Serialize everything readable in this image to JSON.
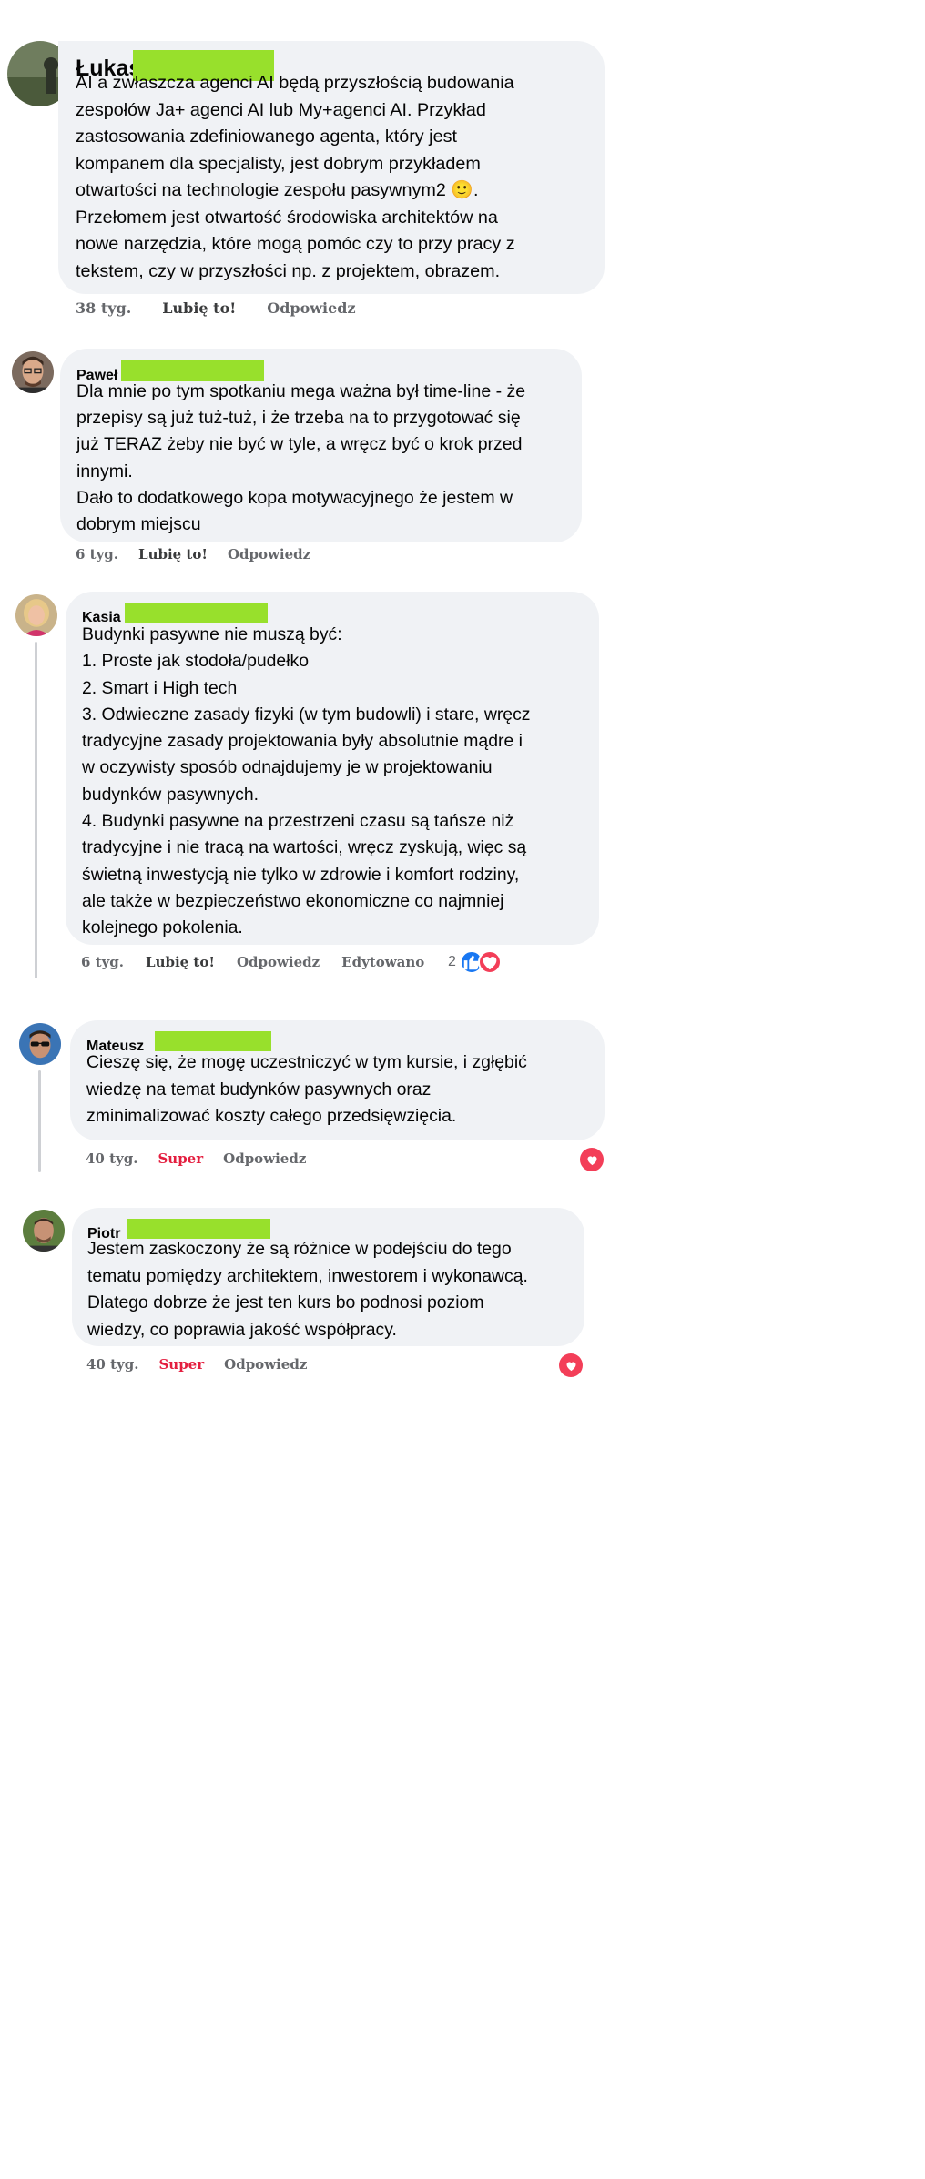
{
  "comments": [
    {
      "author": "Łukasz",
      "text": "AI a zwłaszcza agenci AI będą przyszłością budowania\nzespołów Ja+ agenci AI lub My+agenci AI. Przykład\nzastosowania zdefiniowanego agenta, który jest\nkompanem dla specjalisty, jest dobrym przykładem\notwartości na technologie zespołu pasywnym2 🙂.\nPrzełomem jest otwartość środowiska architektów na\nnowe narzędzia, które mogą pomóc czy to przy pracy z\ntekstem, czy w przyszłości np. z projektem, obrazem.",
      "time": "38 tyg.",
      "reaction_label": "Lubię to!",
      "reply_label": "Odpowiedz"
    },
    {
      "author": "Paweł",
      "text": "Dla mnie po tym spotkaniu mega ważna był time-line - że\nprzepisy są już tuż-tuż, i że trzeba na to przygotować się\njuż TERAZ żeby nie być w tyle, a wręcz być o krok przed\ninnymi.\nDało to dodatkowego kopa motywacyjnego że jestem w\ndobrym miejscu",
      "time": "6 tyg.",
      "reaction_label": "Lubię to!",
      "reply_label": "Odpowiedz"
    },
    {
      "author": "Kasia",
      "text": "Budynki pasywne nie muszą być:\n1. Proste jak stodoła/pudełko\n2. Smart i High tech\n3. Odwieczne zasady fizyki (w tym budowli) i stare, wręcz\ntradycyjne zasady projektowania były absolutnie mądre i\nw oczywisty sposób odnajdujemy je w projektowaniu\nbudynków pasywnych.\n4. Budynki pasywne na przestrzeni czasu są tańsze niż\ntradycyjne i nie tracą na wartości, wręcz zyskują, więc są\nświetną inwestycją nie tylko w zdrowie i komfort rodziny,\nale także w bezpieczeństwo ekonomiczne co najmniej\nkolejnego pokolenia.",
      "time": "6 tyg.",
      "reaction_label": "Lubię to!",
      "reply_label": "Odpowiedz",
      "edited_label": "Edytowano",
      "reaction_count": "2",
      "reactions": [
        "like-icon",
        "love-icon"
      ]
    },
    {
      "author": "Mateusz",
      "text": "Cieszę się, że mogę uczestniczyć w tym kursie, i zgłębić\nwiedzę na temat budynków pasywnych oraz\nzminimalizować koszty całego przedsięwzięcia.",
      "time": "40 tyg.",
      "reaction_label": "Super",
      "reply_label": "Odpowiedz",
      "reactions": [
        "love-icon"
      ]
    },
    {
      "author": "Piotr",
      "text": "Jestem zaskoczony że są różnice w podejściu do tego\ntematu pomiędzy architektem, inwestorem i wykonawcą.\nDlatego dobrze że jest ten kurs bo podnosi poziom\nwiedzy, co poprawia jakość współpracy.",
      "time": "40 tyg.",
      "reaction_label": "Super",
      "reply_label": "Odpowiedz",
      "reactions": [
        "love-icon"
      ]
    }
  ],
  "colors": {
    "bubble": "#f0f2f5",
    "redaction": "#98e02c",
    "like_blue": "#1877f2",
    "love_red": "#f33e58",
    "super_red": "#e41e3f",
    "meta_gray": "#65676b"
  }
}
